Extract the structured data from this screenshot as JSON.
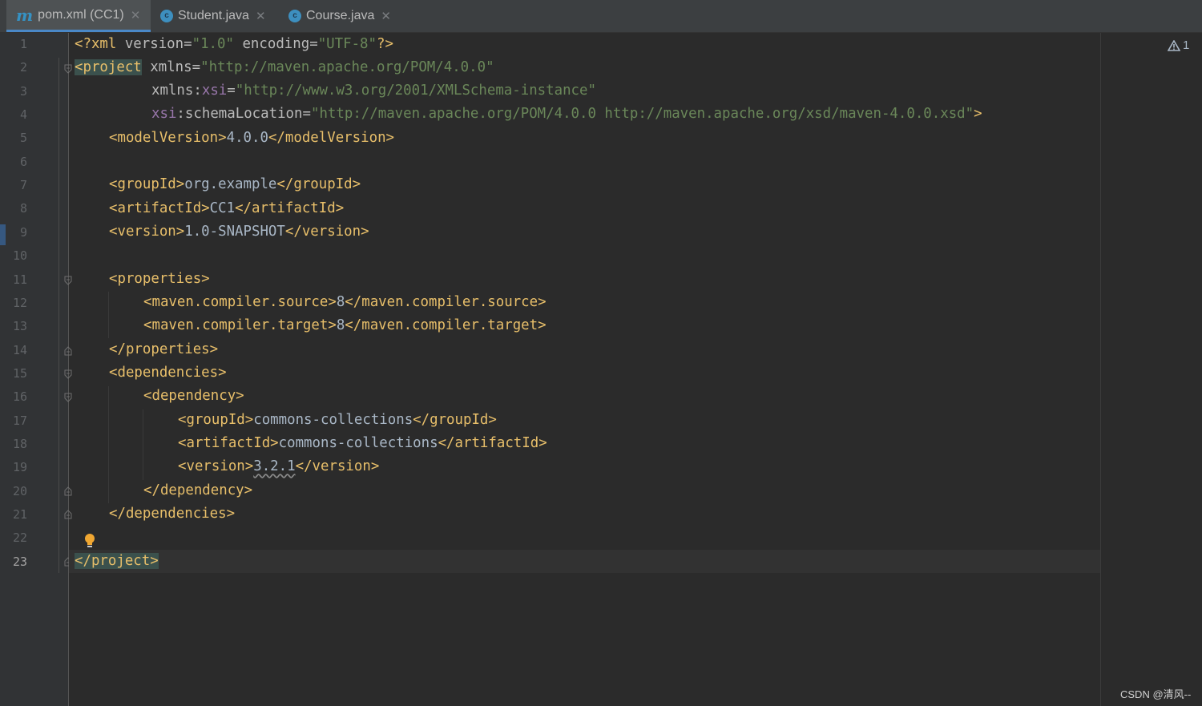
{
  "tabs": [
    {
      "icon": "m",
      "label": "pom.xml (CC1)",
      "active": true
    },
    {
      "icon": "c",
      "label": "Student.java",
      "active": false
    },
    {
      "icon": "c",
      "label": "Course.java",
      "active": false
    }
  ],
  "tab_close_glyph": "✕",
  "class_icon_letter": "c",
  "maven_icon_letter": "m",
  "line_numbers": [
    "1",
    "2",
    "3",
    "4",
    "5",
    "6",
    "7",
    "8",
    "9",
    "10",
    "11",
    "12",
    "13",
    "14",
    "15",
    "16",
    "17",
    "18",
    "19",
    "20",
    "21",
    "22",
    "23"
  ],
  "current_line": "23",
  "code": {
    "l1": {
      "open": "<?xml ",
      "a1": "version",
      "eq1": "=",
      "v1": "\"1.0\"",
      "sp": " ",
      "a2": "encoding",
      "eq2": "=",
      "v2": "\"UTF-8\"",
      "close": "?>"
    },
    "l2": {
      "tag": "<project",
      "sp": " ",
      "attr": "xmlns",
      "eq": "=",
      "val": "\"http://maven.apache.org/POM/4.0.0\""
    },
    "l3": {
      "attr": "xmlns",
      "colon": ":",
      "ns": "xsi",
      "eq": "=",
      "val": "\"http://www.w3.org/2001/XMLSchema-instance\""
    },
    "l4": {
      "ns": "xsi",
      "colon": ":",
      "attr": "schemaLocation",
      "eq": "=",
      "val": "\"http://maven.apache.org/POM/4.0.0 http://maven.apache.org/xsd/maven-4.0.0.xsd\"",
      "close": ">"
    },
    "l5": {
      "open": "<modelVersion>",
      "text": "4.0.0",
      "close": "</modelVersion>"
    },
    "l7": {
      "open": "<groupId>",
      "text": "org.example",
      "close": "</groupId>"
    },
    "l8": {
      "open": "<artifactId>",
      "text": "CC1",
      "close": "</artifactId>"
    },
    "l9": {
      "open": "<version>",
      "text": "1.0-SNAPSHOT",
      "close": "</version>"
    },
    "l11": {
      "open": "<properties>"
    },
    "l12": {
      "open": "<maven.compiler.source>",
      "text": "8",
      "close": "</maven.compiler.source>"
    },
    "l13": {
      "open": "<maven.compiler.target>",
      "text": "8",
      "close": "</maven.compiler.target>"
    },
    "l14": {
      "close": "</properties>"
    },
    "l15": {
      "open": "<dependencies>"
    },
    "l16": {
      "open": "<dependency>"
    },
    "l17": {
      "open": "<groupId>",
      "text": "commons-collections",
      "close": "</groupId>"
    },
    "l18": {
      "open": "<artifactId>",
      "text": "commons-collections",
      "close": "</artifactId>"
    },
    "l19": {
      "open": "<version>",
      "text": "3.2.1",
      "close": "</version>"
    },
    "l20": {
      "close": "</dependency>"
    },
    "l21": {
      "close": "</dependencies>"
    },
    "l23": {
      "close": "</project>"
    }
  },
  "warnings": {
    "count": "1"
  },
  "watermark": "CSDN @清风--",
  "colors": {
    "tag": "#e8bf6a",
    "string": "#6a8759",
    "namespace": "#9876aa",
    "text": "#a9b7c6",
    "accent": "#4a88c7"
  }
}
